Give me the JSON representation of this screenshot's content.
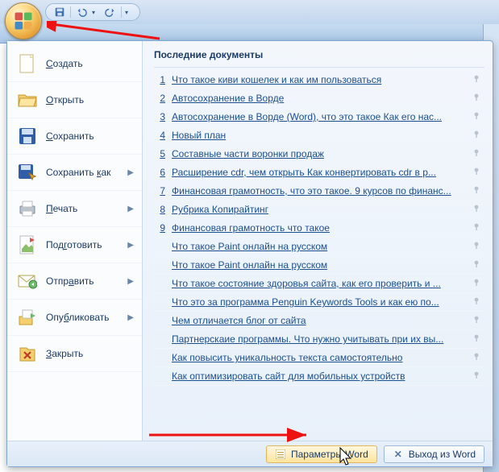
{
  "qat": {
    "save_tip": "Сохранить",
    "undo_tip": "Отменить",
    "redo_tip": "Повторить"
  },
  "office_button": "Office",
  "menu": {
    "items": [
      {
        "label": "Создать",
        "icon": "new",
        "submenu": false
      },
      {
        "label": "Открыть",
        "icon": "open",
        "submenu": false
      },
      {
        "label": "Сохранить",
        "icon": "save",
        "submenu": false
      },
      {
        "label": "Сохранить как",
        "icon": "saveas",
        "submenu": true,
        "mn": "к"
      },
      {
        "label": "Печать",
        "icon": "print",
        "submenu": true
      },
      {
        "label": "Подготовить",
        "icon": "prepare",
        "submenu": true
      },
      {
        "label": "Отправить",
        "icon": "send",
        "submenu": true
      },
      {
        "label": "Опубликовать",
        "icon": "publish",
        "submenu": true
      },
      {
        "label": "Закрыть",
        "icon": "close",
        "submenu": false
      }
    ]
  },
  "recent": {
    "title": "Последние документы",
    "docs": [
      {
        "n": "1",
        "label": "Что такое киви кошелек и как им пользоваться"
      },
      {
        "n": "2",
        "label": "Автосохранение в Ворде"
      },
      {
        "n": "3",
        "label": "Автосохранение в Ворде (Word), что это такое Как его нас..."
      },
      {
        "n": "4",
        "label": "Новый план"
      },
      {
        "n": "5",
        "label": "Составные части воронки продаж"
      },
      {
        "n": "6",
        "label": "Расширение cdr, чем открыть  Как конвертировать cdr в p..."
      },
      {
        "n": "7",
        "label": "Финансовая грамотность, что это такое. 9 курсов по финанс..."
      },
      {
        "n": "8",
        "label": "Рубрика Копирайтинг"
      },
      {
        "n": "9",
        "label": "Финансовая грамотность что такое"
      },
      {
        "n": "",
        "label": "Что такое Paint онлайн на русском"
      },
      {
        "n": "",
        "label": "Что такое Paint онлайн на русском"
      },
      {
        "n": "",
        "label": "Что такое состояние здоровья сайта, как его проверить и ..."
      },
      {
        "n": "",
        "label": "Что это за программа Penguin Keywords Tools и как ею по..."
      },
      {
        "n": "",
        "label": "Чем отличается блог от сайта"
      },
      {
        "n": "",
        "label": "Партнерскаие программы. Что нужно учитывать при их вы..."
      },
      {
        "n": "",
        "label": "Как повысить уникальность текста самостоятельно"
      },
      {
        "n": "",
        "label": "Как оптимизировать сайт для мобильных устройств"
      }
    ]
  },
  "footer": {
    "options": "Параметры Word",
    "exit": "Выход из Word"
  }
}
